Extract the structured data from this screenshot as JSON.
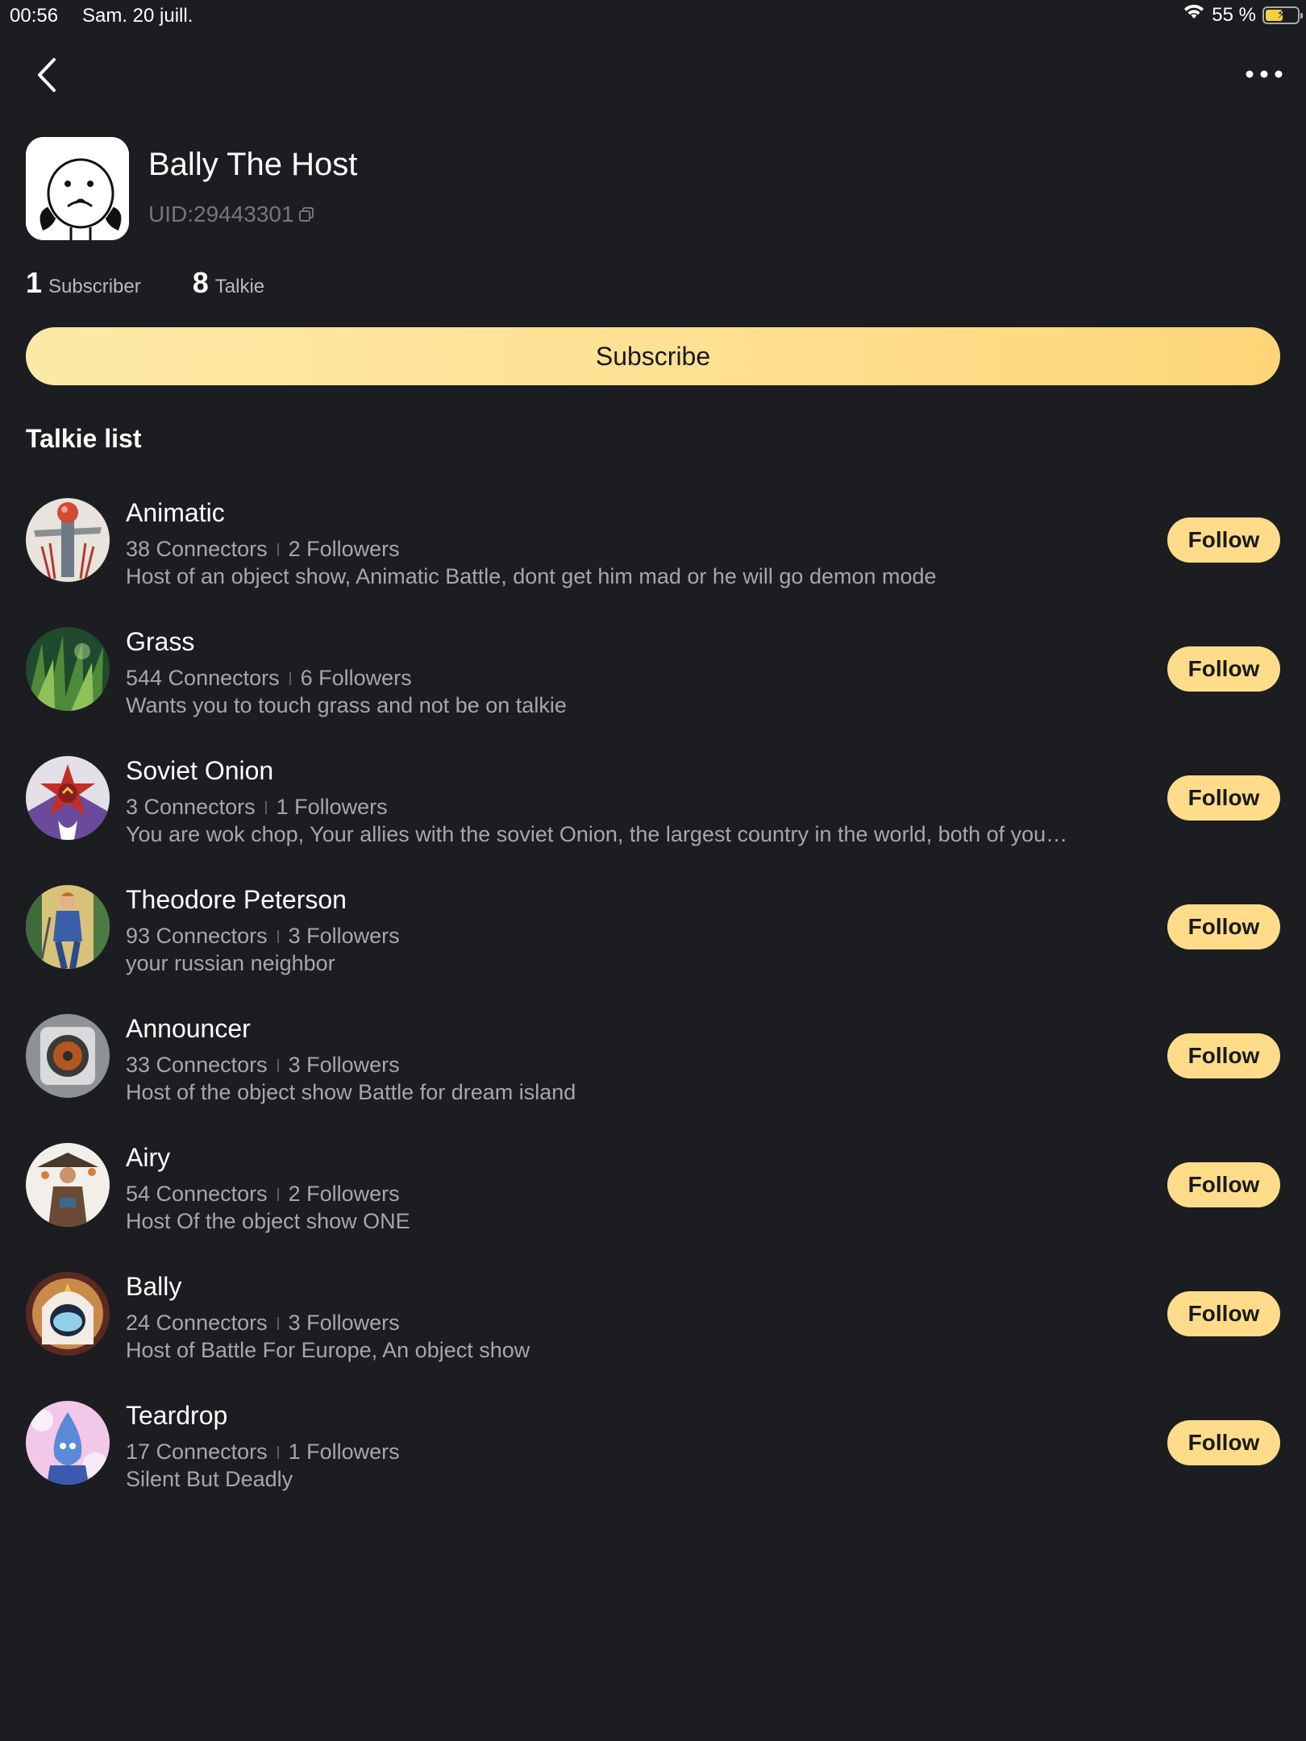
{
  "status_bar": {
    "time": "00:56",
    "date": "Sam. 20 juill.",
    "battery": "55 %",
    "battery_level": 0.55
  },
  "nav": {
    "back_icon": "chevron-left-icon",
    "more_icon": "ellipsis-icon"
  },
  "profile": {
    "name": "Bally The Host",
    "uid": "UID:29443301",
    "subscribers_count": "1",
    "subscribers_label": "Subscriber",
    "talkies_count": "8",
    "talkies_label": "Talkie",
    "subscribe_label": "Subscribe"
  },
  "talkie_list": {
    "title": "Talkie list",
    "follow_label": "Follow",
    "items": [
      {
        "name": "Animatic",
        "connectors": "38 Connectors",
        "followers": "2 Followers",
        "description": "Host of an object show, Animatic Battle, dont get him mad or he will go demon mode"
      },
      {
        "name": "Grass",
        "connectors": "544 Connectors",
        "followers": "6 Followers",
        "description": "Wants you to touch grass and not be on talkie"
      },
      {
        "name": "Soviet Onion",
        "connectors": "3 Connectors",
        "followers": "1 Followers",
        "description": "You are wok chop, Your allies with the soviet Onion, the largest country in the world, both of you…"
      },
      {
        "name": "Theodore Peterson",
        "connectors": "93 Connectors",
        "followers": "3 Followers",
        "description": "your russian neighbor"
      },
      {
        "name": "Announcer",
        "connectors": "33 Connectors",
        "followers": "3 Followers",
        "description": "Host of the object show Battle for dream island"
      },
      {
        "name": "Airy",
        "connectors": "54 Connectors",
        "followers": "2 Followers",
        "description": "Host Of the object show ONE"
      },
      {
        "name": "Bally",
        "connectors": "24 Connectors",
        "followers": "3 Followers",
        "description": "Host of Battle For Europe, An object show"
      },
      {
        "name": "Teardrop",
        "connectors": "17 Connectors",
        "followers": "1 Followers",
        "description": "Silent But Deadly"
      }
    ]
  }
}
